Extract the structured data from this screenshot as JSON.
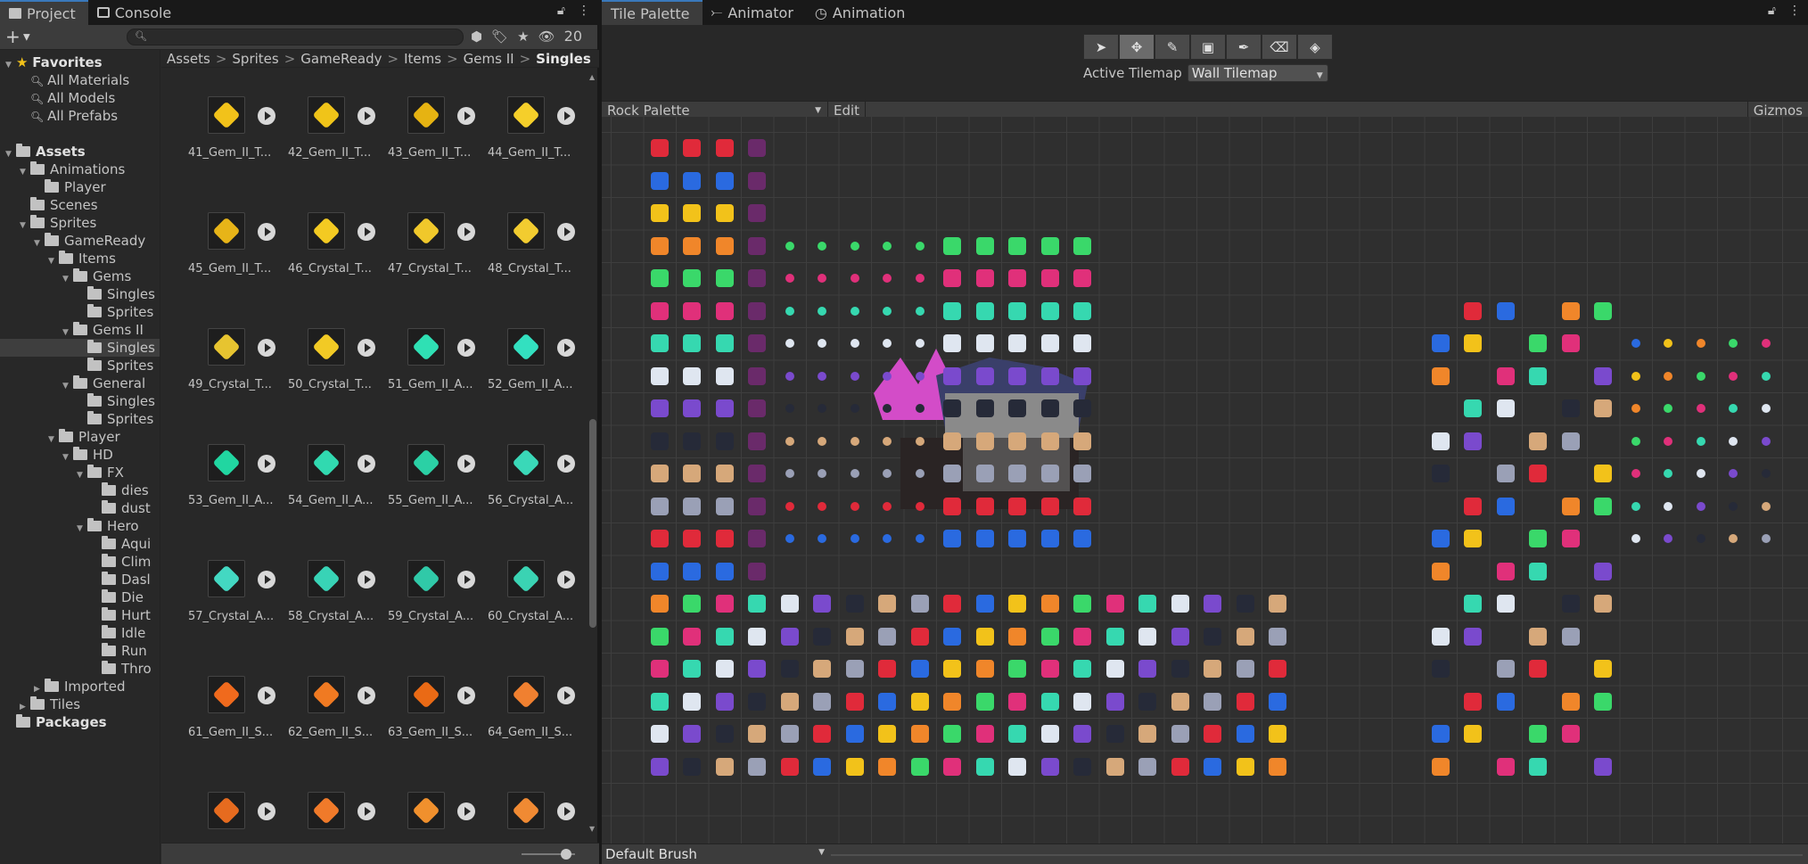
{
  "left_tabs": [
    {
      "label": "Project",
      "icon": "folder-icon",
      "active": true
    },
    {
      "label": "Console",
      "icon": "console-icon",
      "active": false
    }
  ],
  "project_toolbar": {
    "hidden_count": "20",
    "search_placeholder": ""
  },
  "tree": [
    {
      "label": "Favorites",
      "depth": 0,
      "kind": "star",
      "bold": true,
      "expanded": true
    },
    {
      "label": "All Materials",
      "depth": 1,
      "kind": "search"
    },
    {
      "label": "All Models",
      "depth": 1,
      "kind": "search"
    },
    {
      "label": "All Prefabs",
      "depth": 1,
      "kind": "search"
    },
    {
      "label": "",
      "depth": 0,
      "kind": "blank"
    },
    {
      "label": "Assets",
      "depth": 0,
      "kind": "folder",
      "bold": true,
      "expanded": true
    },
    {
      "label": "Animations",
      "depth": 1,
      "kind": "folder",
      "expanded": true
    },
    {
      "label": "Player",
      "depth": 2,
      "kind": "folder"
    },
    {
      "label": "Scenes",
      "depth": 1,
      "kind": "folder"
    },
    {
      "label": "Sprites",
      "depth": 1,
      "kind": "folder",
      "expanded": true
    },
    {
      "label": "GameReady",
      "depth": 2,
      "kind": "folder",
      "expanded": true
    },
    {
      "label": "Items",
      "depth": 3,
      "kind": "folder",
      "expanded": true
    },
    {
      "label": "Gems",
      "depth": 4,
      "kind": "folder",
      "expanded": true
    },
    {
      "label": "Singles",
      "depth": 5,
      "kind": "folder"
    },
    {
      "label": "Sprites",
      "depth": 5,
      "kind": "folder"
    },
    {
      "label": "Gems II",
      "depth": 4,
      "kind": "folder",
      "expanded": true
    },
    {
      "label": "Singles",
      "depth": 5,
      "kind": "folder",
      "selected": true
    },
    {
      "label": "Sprites",
      "depth": 5,
      "kind": "folder"
    },
    {
      "label": "General",
      "depth": 4,
      "kind": "folder",
      "expanded": true
    },
    {
      "label": "Singles",
      "depth": 5,
      "kind": "folder"
    },
    {
      "label": "Sprites",
      "depth": 5,
      "kind": "folder"
    },
    {
      "label": "Player",
      "depth": 3,
      "kind": "folder",
      "expanded": true
    },
    {
      "label": "HD",
      "depth": 4,
      "kind": "folder",
      "expanded": true
    },
    {
      "label": "FX",
      "depth": 5,
      "kind": "folder",
      "expanded": true
    },
    {
      "label": "dies",
      "depth": 6,
      "kind": "folder"
    },
    {
      "label": "dust",
      "depth": 6,
      "kind": "folder"
    },
    {
      "label": "Hero",
      "depth": 5,
      "kind": "folder",
      "expanded": true
    },
    {
      "label": "Aqui",
      "depth": 6,
      "kind": "folder"
    },
    {
      "label": "Clim",
      "depth": 6,
      "kind": "folder"
    },
    {
      "label": "Dasl",
      "depth": 6,
      "kind": "folder"
    },
    {
      "label": "Die",
      "depth": 6,
      "kind": "folder"
    },
    {
      "label": "Hurt",
      "depth": 6,
      "kind": "folder"
    },
    {
      "label": "Idle",
      "depth": 6,
      "kind": "folder"
    },
    {
      "label": "Run",
      "depth": 6,
      "kind": "folder"
    },
    {
      "label": "Thro",
      "depth": 6,
      "kind": "folder"
    },
    {
      "label": "Imported",
      "depth": 2,
      "kind": "folder",
      "collapsed": true
    },
    {
      "label": "Tiles",
      "depth": 1,
      "kind": "folder",
      "collapsed": true
    },
    {
      "label": "Packages",
      "depth": 0,
      "kind": "folder",
      "bold": true
    }
  ],
  "breadcrumb": [
    "Assets",
    "Sprites",
    "GameReady",
    "Items",
    "Gems II",
    "Singles"
  ],
  "assets": [
    {
      "label": "41_Gem_II_T...",
      "color": "#f2c21a"
    },
    {
      "label": "42_Gem_II_T...",
      "color": "#f0c419"
    },
    {
      "label": "43_Gem_II_T...",
      "color": "#e6b312"
    },
    {
      "label": "44_Gem_II_T...",
      "color": "#f5cf2a"
    },
    {
      "label": "45_Gem_II_T...",
      "color": "#e7b418"
    },
    {
      "label": "46_Crystal_T...",
      "color": "#f3ca22"
    },
    {
      "label": "47_Crystal_T...",
      "color": "#f0c82b"
    },
    {
      "label": "48_Crystal_T...",
      "color": "#f2cc30"
    },
    {
      "label": "49_Crystal_T...",
      "color": "#e7c430"
    },
    {
      "label": "50_Crystal_T...",
      "color": "#f2ca25"
    },
    {
      "label": "51_Gem_II_A...",
      "color": "#2fe0b4"
    },
    {
      "label": "52_Gem_II_A...",
      "color": "#33e0c0"
    },
    {
      "label": "53_Gem_II_A...",
      "color": "#21d6a1"
    },
    {
      "label": "54_Gem_II_A...",
      "color": "#31d9b0"
    },
    {
      "label": "55_Gem_II_A...",
      "color": "#2bd0a5"
    },
    {
      "label": "56_Crystal_A...",
      "color": "#3ad8b8"
    },
    {
      "label": "57_Crystal_A...",
      "color": "#43d8c2"
    },
    {
      "label": "58_Crystal_A...",
      "color": "#38d3b6"
    },
    {
      "label": "59_Crystal_A...",
      "color": "#30c9a8"
    },
    {
      "label": "60_Crystal_A...",
      "color": "#3ad3b3"
    },
    {
      "label": "61_Gem_II_S...",
      "color": "#f06a1d"
    },
    {
      "label": "62_Gem_II_S...",
      "color": "#f07a22"
    },
    {
      "label": "63_Gem_II_S...",
      "color": "#ea6a15"
    },
    {
      "label": "64_Gem_II_S...",
      "color": "#f08030"
    },
    {
      "label": "",
      "color": "#e66b1f"
    },
    {
      "label": "",
      "color": "#f07a2a"
    },
    {
      "label": "",
      "color": "#f0902d"
    },
    {
      "label": "",
      "color": "#f08a33"
    }
  ],
  "right_tabs": [
    {
      "label": "Tile Palette",
      "icon": "",
      "active": true
    },
    {
      "label": "Animator",
      "icon": "animator-icon",
      "active": false
    },
    {
      "label": "Animation",
      "icon": "clock-icon",
      "active": false
    }
  ],
  "tools": [
    {
      "name": "select-tool-icon",
      "glyph": "➤"
    },
    {
      "name": "move-tool-icon",
      "glyph": "✥",
      "active": true
    },
    {
      "name": "paint-brush-icon",
      "glyph": "✎"
    },
    {
      "name": "box-fill-icon",
      "glyph": "▣"
    },
    {
      "name": "picker-icon",
      "glyph": "✒"
    },
    {
      "name": "eraser-icon",
      "glyph": "⌫"
    },
    {
      "name": "fill-bucket-icon",
      "glyph": "◈"
    }
  ],
  "active_tilemap": {
    "label": "Active Tilemap",
    "value": "Wall Tilemap"
  },
  "palette_bar": {
    "palette": "Rock Palette",
    "edit": "Edit",
    "gizmos": "Gizmos"
  },
  "brush": "Default Brush",
  "tile_colors": [
    "#e02a3a",
    "#2a6ae0",
    "#f2c21a",
    "#f0862a",
    "#3ad86a",
    "#e0307a",
    "#36d8b0",
    "#dfe6f0",
    "#7a4acd",
    "#262a38",
    "#d6a87a",
    "#9aa0b6"
  ]
}
